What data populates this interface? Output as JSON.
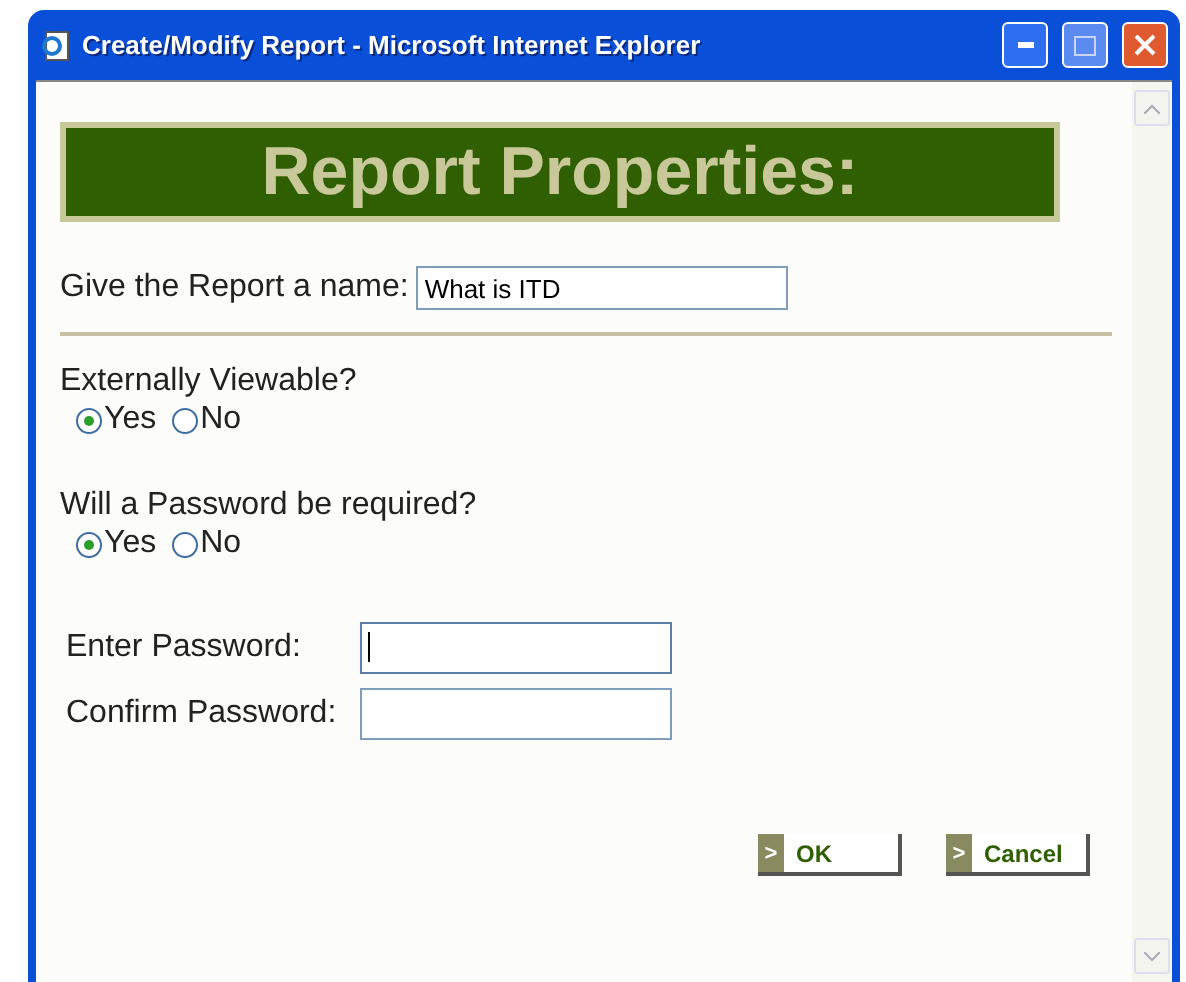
{
  "window": {
    "title": "Create/Modify Report - Microsoft Internet Explorer"
  },
  "banner": {
    "title": "Report Properties:"
  },
  "name_field": {
    "label": "Give the Report a name:",
    "value": "What is ITD"
  },
  "questions": [
    {
      "label": "Externally Viewable?",
      "options": [
        {
          "label": "Yes",
          "selected": true
        },
        {
          "label": "No",
          "selected": false
        }
      ]
    },
    {
      "label": "Will a Password be required?",
      "options": [
        {
          "label": "Yes",
          "selected": true
        },
        {
          "label": "No",
          "selected": false
        }
      ]
    }
  ],
  "password_fields": [
    {
      "label": "Enter Password:",
      "focused": true
    },
    {
      "label": "Confirm Password:",
      "focused": false
    }
  ],
  "buttons": [
    {
      "glyph": ">",
      "label": "OK"
    },
    {
      "glyph": ">",
      "label": "Cancel"
    }
  ]
}
